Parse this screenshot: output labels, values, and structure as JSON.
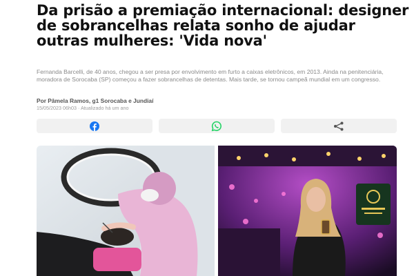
{
  "article": {
    "headline": "Da prisão a premiação internacional: designer de sobrancelhas relata sonho de ajudar outras mulheres: 'Vida nova'",
    "summary": "Fernanda Barcelli, de 40 anos, chegou a ser presa por envolvimento em furto a caixas eletrônicos, em 2013. Ainda na penitenciária, moradora de Sorocaba (SP) começou a fazer sobrancelhas de detentas. Mais tarde, se tornou campeã mundial em um congresso.",
    "byline": "Por Pâmela Ramos, g1 Sorocaba e Jundiaí",
    "dateline": "15/05/2023 06h03 · Atualizado há um ano"
  },
  "share": {
    "buttons": [
      {
        "network": "facebook",
        "icon": "facebook-icon",
        "color": "#1877f2"
      },
      {
        "network": "whatsapp",
        "icon": "whatsapp-icon",
        "color": "#25d366"
      },
      {
        "network": "share",
        "icon": "share-icon",
        "color": "#555555"
      }
    ]
  },
  "photos": [
    {
      "subject": "designer-at-work"
    },
    {
      "subject": "award-holder"
    }
  ]
}
